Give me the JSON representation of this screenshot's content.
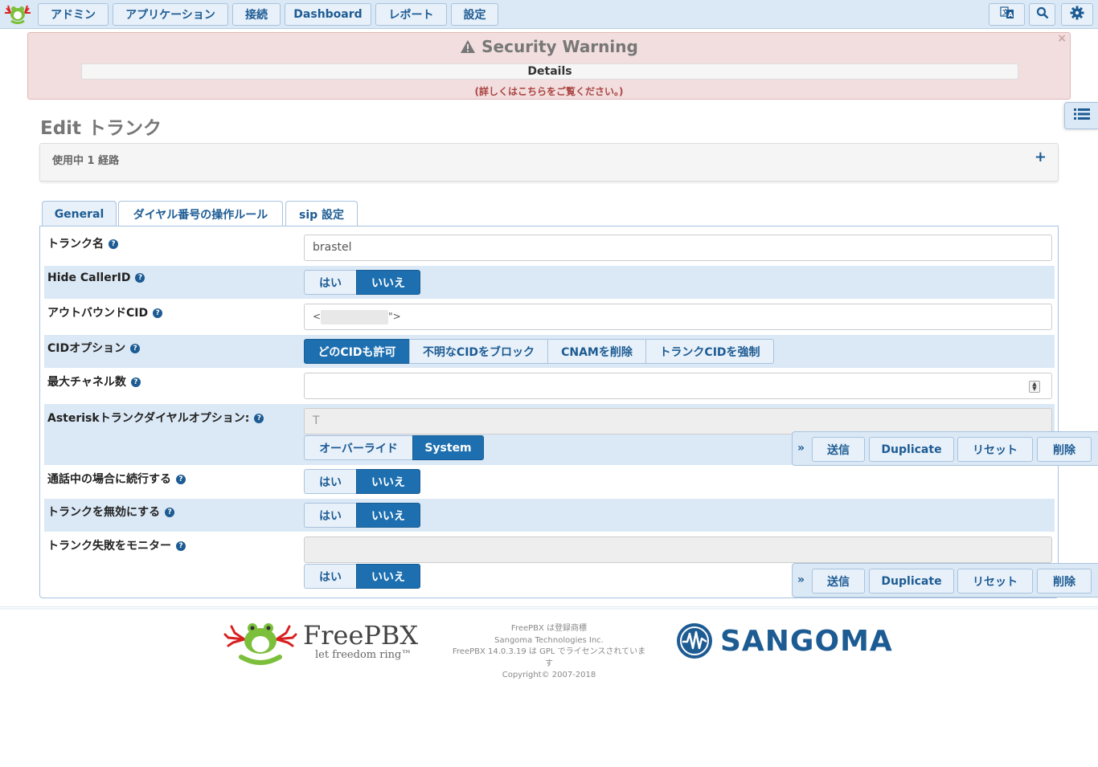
{
  "nav": {
    "items": [
      "アドミン",
      "アプリケーション",
      "接続",
      "Dashboard",
      "レポート",
      "設定"
    ]
  },
  "warning": {
    "title": "Security Warning",
    "details_label": "Details",
    "subtext": "(詳しくはこちらをご覧ください。)",
    "close": "×"
  },
  "page": {
    "title": "Edit トランク",
    "routes_label": "使用中 1 経路",
    "routes_toggle": "+"
  },
  "tabs": [
    "General",
    "ダイヤル番号の操作ルール",
    "sip 設定"
  ],
  "form": {
    "trunk_name": {
      "label": "トランク名",
      "value": "brastel"
    },
    "hide_callerid": {
      "label": "Hide CallerID",
      "options": [
        "はい",
        "いいえ"
      ],
      "selected": "いいえ"
    },
    "outbound_cid": {
      "label": "アウトバウンドCID",
      "prefix": "<",
      "suffix": "\">"
    },
    "cid_options": {
      "label": "CIDオプション",
      "options": [
        "どのCIDも許可",
        "不明なCIDをブロック",
        "CNAMを削除",
        "トランクCIDを強制"
      ],
      "selected": "どのCIDも許可"
    },
    "max_channels": {
      "label": "最大チャネル数",
      "value": ""
    },
    "dial_options": {
      "label": "Asteriskトランクダイヤルオプション:",
      "value": "T",
      "options": [
        "オーバーライド",
        "System"
      ],
      "selected": "System"
    },
    "continue_if_busy": {
      "label": "通話中の場合に続行する",
      "options": [
        "はい",
        "いいえ"
      ],
      "selected": "いいえ"
    },
    "disable_trunk": {
      "label": "トランクを無効にする",
      "options": [
        "はい",
        "いいえ"
      ],
      "selected": "いいえ"
    },
    "monitor_failures": {
      "label": "トランク失敗をモニター",
      "value": "",
      "options": [
        "はい",
        "いいえ"
      ],
      "selected": "いいえ"
    }
  },
  "actions": {
    "chevron": "»",
    "submit": "送信",
    "duplicate": "Duplicate",
    "reset": "リセット",
    "delete": "削除"
  },
  "footer": {
    "freepbx": "FreePBX",
    "tagline": "let freedom ring™",
    "legal_lines": [
      "FreePBX は登録商標",
      "Sangoma Technologies Inc.",
      "FreePBX 14.0.3.19 は GPL でライセンスされています",
      "Copyright© 2007-2018"
    ],
    "sangoma": "SANGOMA"
  },
  "colors": {
    "brand": "#1d5b93",
    "active": "#1d6fb0",
    "nav_bg": "#dbe8f5",
    "warning_bg": "#f2dede"
  }
}
